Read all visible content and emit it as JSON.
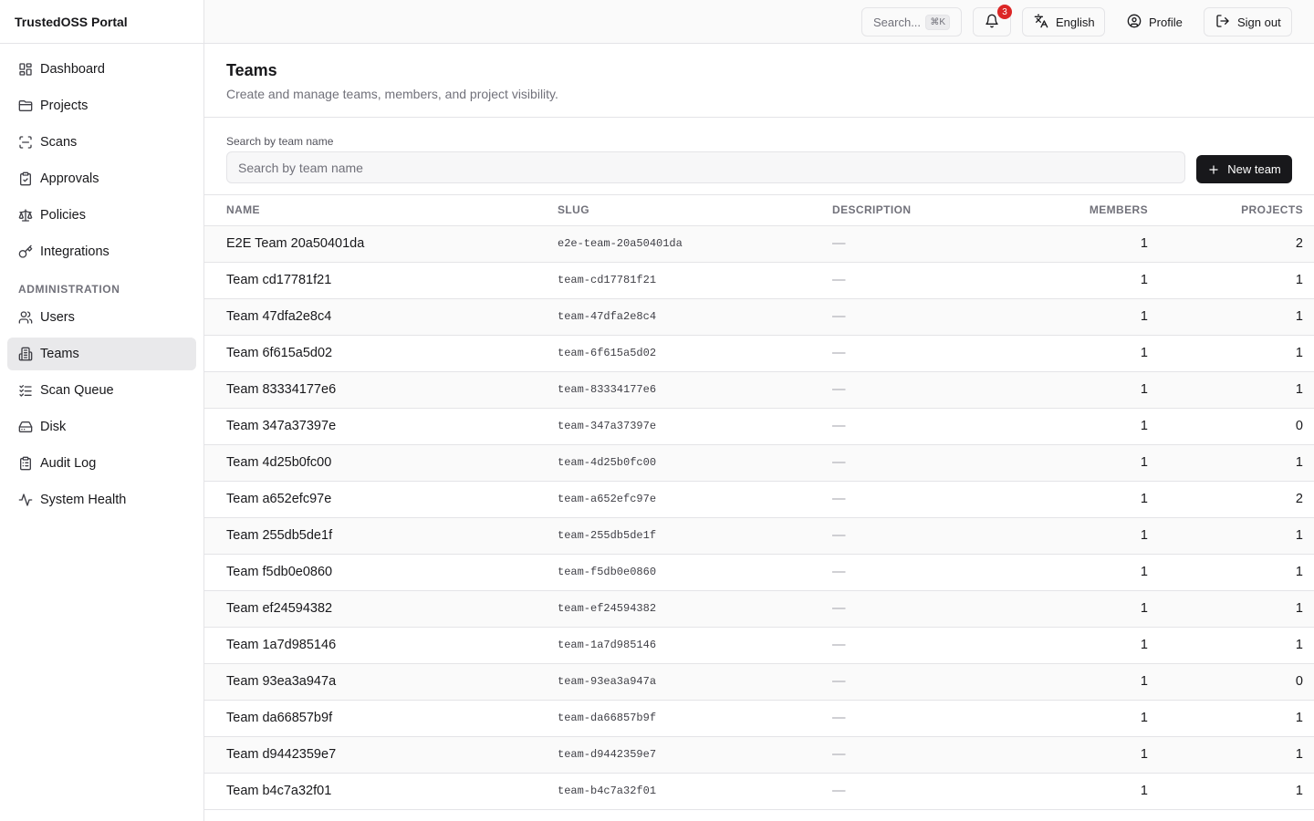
{
  "app": {
    "title": "TrustedOSS Portal"
  },
  "sidebar": {
    "items": [
      {
        "label": "Dashboard",
        "icon": "dashboard-icon"
      },
      {
        "label": "Projects",
        "icon": "folder-icon"
      },
      {
        "label": "Scans",
        "icon": "scan-icon"
      },
      {
        "label": "Approvals",
        "icon": "clipboard-check-icon"
      },
      {
        "label": "Policies",
        "icon": "scale-icon"
      },
      {
        "label": "Integrations",
        "icon": "key-icon"
      }
    ],
    "admin_label": "ADMINISTRATION",
    "admin_items": [
      {
        "label": "Users",
        "icon": "users-icon"
      },
      {
        "label": "Teams",
        "icon": "teams-icon",
        "active": true
      },
      {
        "label": "Scan Queue",
        "icon": "list-check-icon"
      },
      {
        "label": "Disk",
        "icon": "hard-drive-icon"
      },
      {
        "label": "Audit Log",
        "icon": "clipboard-list-icon"
      },
      {
        "label": "System Health",
        "icon": "activity-icon"
      }
    ]
  },
  "topbar": {
    "search_label": "Search...",
    "search_shortcut": "⌘K",
    "notification_count": "3",
    "language_label": "English",
    "profile_label": "Profile",
    "signout_label": "Sign out"
  },
  "page": {
    "title": "Teams",
    "subtitle": "Create and manage teams, members, and project visibility."
  },
  "filter": {
    "label": "Search by team name",
    "placeholder": "Search by team name",
    "new_button": "New team"
  },
  "table": {
    "headers": {
      "name": "NAME",
      "slug": "SLUG",
      "description": "DESCRIPTION",
      "members": "MEMBERS",
      "projects": "PROJECTS"
    },
    "rows": [
      {
        "name": "E2E Team 20a50401da",
        "slug": "e2e-team-20a50401da",
        "description": "—",
        "members": "1",
        "projects": "2"
      },
      {
        "name": "Team cd17781f21",
        "slug": "team-cd17781f21",
        "description": "—",
        "members": "1",
        "projects": "1"
      },
      {
        "name": "Team 47dfa2e8c4",
        "slug": "team-47dfa2e8c4",
        "description": "—",
        "members": "1",
        "projects": "1"
      },
      {
        "name": "Team 6f615a5d02",
        "slug": "team-6f615a5d02",
        "description": "—",
        "members": "1",
        "projects": "1"
      },
      {
        "name": "Team 83334177e6",
        "slug": "team-83334177e6",
        "description": "—",
        "members": "1",
        "projects": "1"
      },
      {
        "name": "Team 347a37397e",
        "slug": "team-347a37397e",
        "description": "—",
        "members": "1",
        "projects": "0"
      },
      {
        "name": "Team 4d25b0fc00",
        "slug": "team-4d25b0fc00",
        "description": "—",
        "members": "1",
        "projects": "1"
      },
      {
        "name": "Team a652efc97e",
        "slug": "team-a652efc97e",
        "description": "—",
        "members": "1",
        "projects": "2"
      },
      {
        "name": "Team 255db5de1f",
        "slug": "team-255db5de1f",
        "description": "—",
        "members": "1",
        "projects": "1"
      },
      {
        "name": "Team f5db0e0860",
        "slug": "team-f5db0e0860",
        "description": "—",
        "members": "1",
        "projects": "1"
      },
      {
        "name": "Team ef24594382",
        "slug": "team-ef24594382",
        "description": "—",
        "members": "1",
        "projects": "1"
      },
      {
        "name": "Team 1a7d985146",
        "slug": "team-1a7d985146",
        "description": "—",
        "members": "1",
        "projects": "1"
      },
      {
        "name": "Team 93ea3a947a",
        "slug": "team-93ea3a947a",
        "description": "—",
        "members": "1",
        "projects": "0"
      },
      {
        "name": "Team da66857b9f",
        "slug": "team-da66857b9f",
        "description": "—",
        "members": "1",
        "projects": "1"
      },
      {
        "name": "Team d9442359e7",
        "slug": "team-d9442359e7",
        "description": "—",
        "members": "1",
        "projects": "1"
      },
      {
        "name": "Team b4c7a32f01",
        "slug": "team-b4c7a32f01",
        "description": "—",
        "members": "1",
        "projects": "1"
      }
    ]
  },
  "colors": {
    "primary_button": "#18181b",
    "badge": "#dc2626",
    "active_nav": "#e9e9eb"
  }
}
